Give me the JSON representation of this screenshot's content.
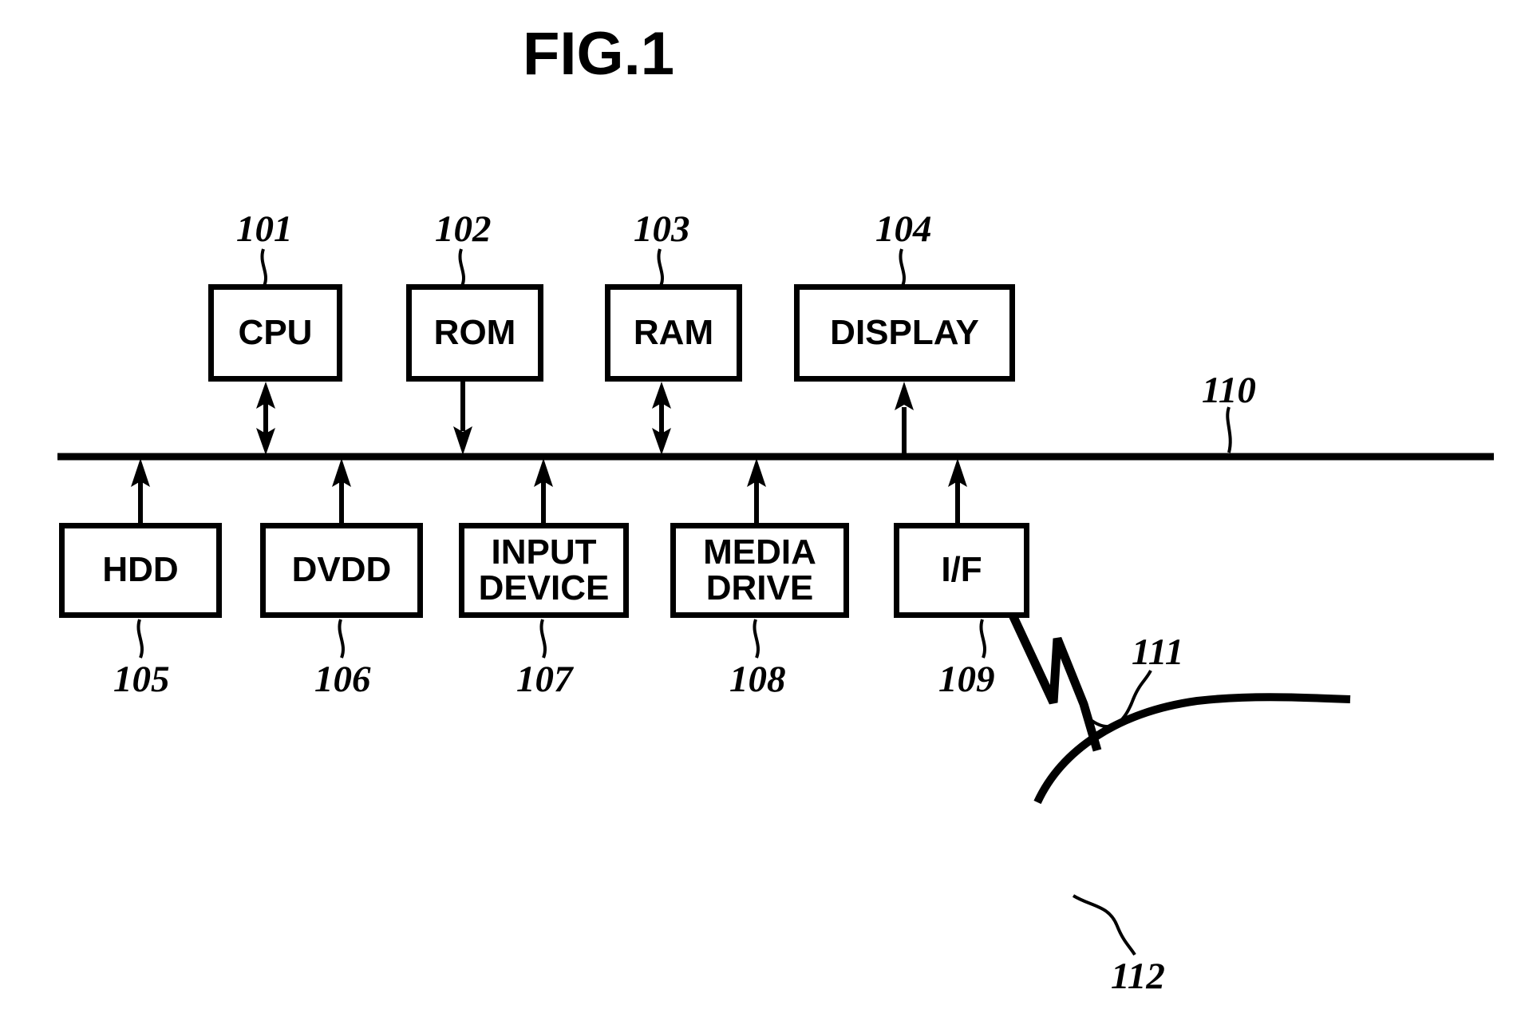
{
  "figure": {
    "title": "FIG.1",
    "type": "patent-block-diagram",
    "description": "Hardware block diagram of an information processing apparatus connected by a system bus"
  },
  "blocks": {
    "cpu": {
      "label": "CPU",
      "ref": "101"
    },
    "rom": {
      "label": "ROM",
      "ref": "102"
    },
    "ram": {
      "label": "RAM",
      "ref": "103"
    },
    "display": {
      "label": "DISPLAY",
      "ref": "104"
    },
    "hdd": {
      "label": "HDD",
      "ref": "105"
    },
    "dvdd": {
      "label": "DVDD",
      "ref": "106"
    },
    "input_device": {
      "label": "INPUT\nDEVICE",
      "ref": "107"
    },
    "media_drive": {
      "label": "MEDIA\nDRIVE",
      "ref": "108"
    },
    "interface": {
      "label": "I/F",
      "ref": "109"
    }
  },
  "bus": {
    "ref": "110",
    "label": ""
  },
  "antenna": {
    "ref": "111",
    "label": ""
  },
  "wave": {
    "ref": "112",
    "label": ""
  },
  "connections": [
    {
      "from": "cpu",
      "to": "bus",
      "arrow": "bidirectional"
    },
    {
      "from": "rom",
      "to": "bus",
      "arrow": "to-bus"
    },
    {
      "from": "ram",
      "to": "bus",
      "arrow": "bidirectional"
    },
    {
      "from": "display",
      "to": "bus",
      "arrow": "from-bus"
    },
    {
      "from": "hdd",
      "to": "bus",
      "arrow": "bidirectional"
    },
    {
      "from": "dvdd",
      "to": "bus",
      "arrow": "bidirectional"
    },
    {
      "from": "input_device",
      "to": "bus",
      "arrow": "to-bus"
    },
    {
      "from": "media_drive",
      "to": "bus",
      "arrow": "bidirectional"
    },
    {
      "from": "interface",
      "to": "bus",
      "arrow": "bidirectional"
    }
  ],
  "colors": {
    "ink": "#000000",
    "paper": "#ffffff"
  }
}
